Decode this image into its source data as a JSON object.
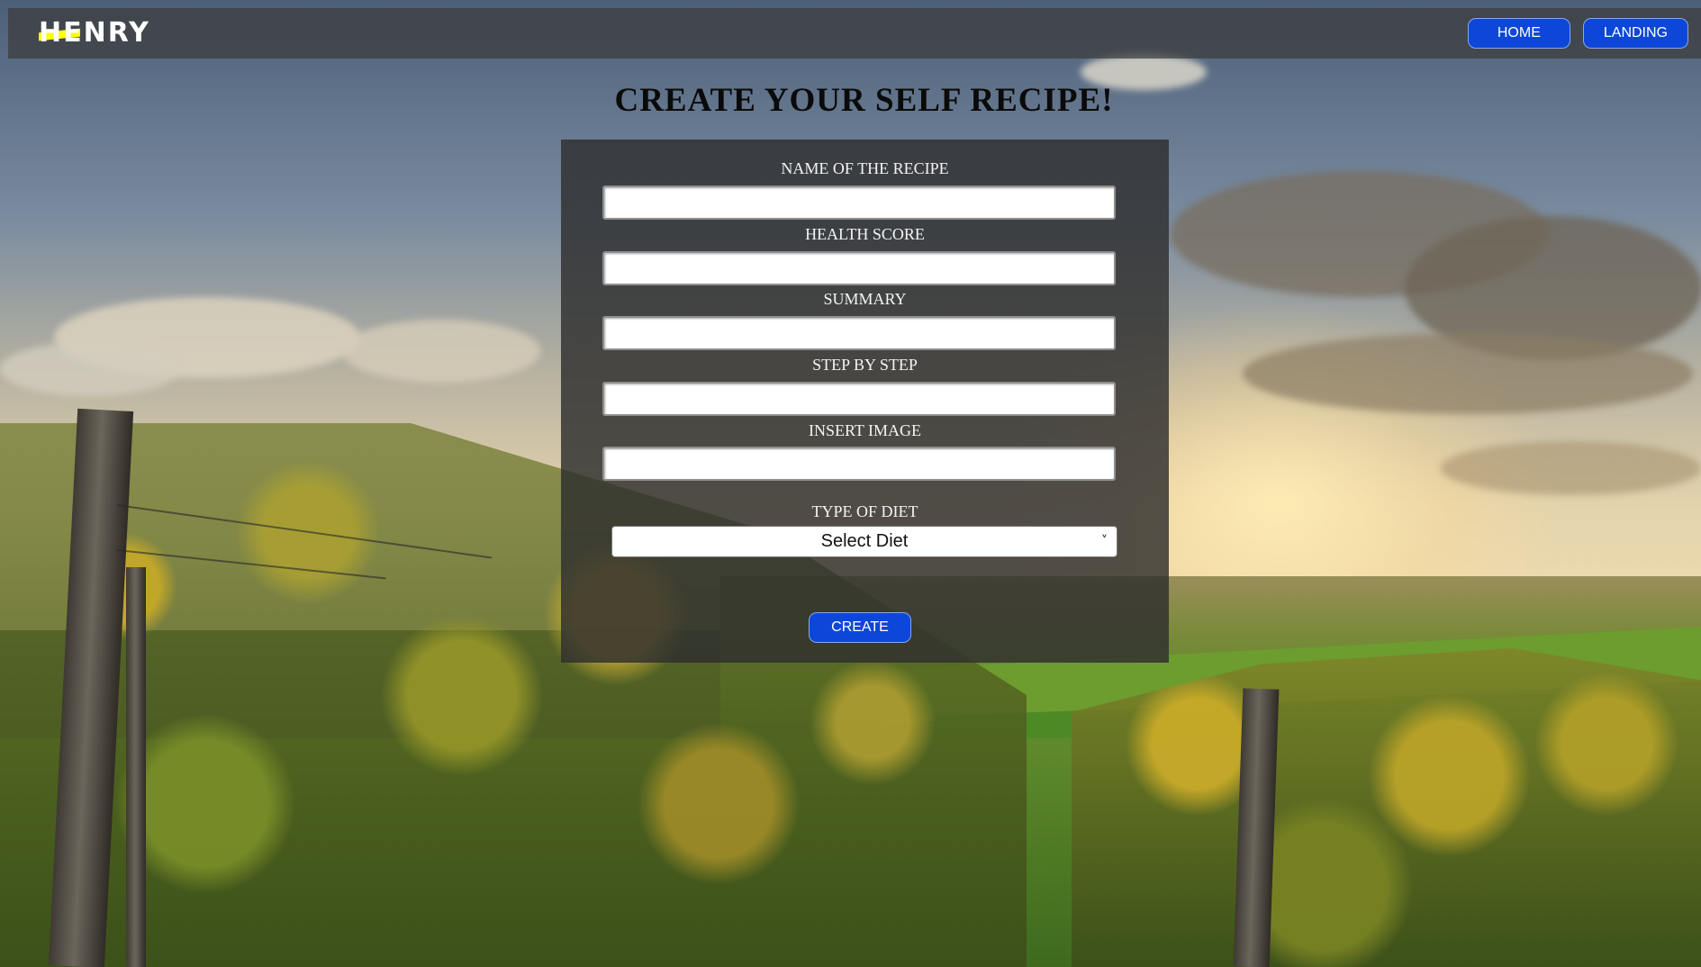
{
  "navbar": {
    "logo_text": "HENRY",
    "buttons": [
      {
        "label": "HOME"
      },
      {
        "label": "LANDING"
      }
    ]
  },
  "page": {
    "title": "CREATE YOUR SELF RECIPE!"
  },
  "form": {
    "fields": [
      {
        "label": "NAME OF THE RECIPE",
        "value": ""
      },
      {
        "label": "HEALTH SCORE",
        "value": ""
      },
      {
        "label": "SUMMARY",
        "value": ""
      },
      {
        "label": "STEP BY STEP",
        "value": ""
      },
      {
        "label": "INSERT IMAGE",
        "value": ""
      }
    ],
    "diet": {
      "label": "TYPE OF DIET",
      "selected": "Select Diet"
    },
    "submit_label": "CREATE"
  },
  "colors": {
    "accent": "#0c47d9",
    "logo_highlight": "#ffff01",
    "panel": "#2e2e2e"
  }
}
